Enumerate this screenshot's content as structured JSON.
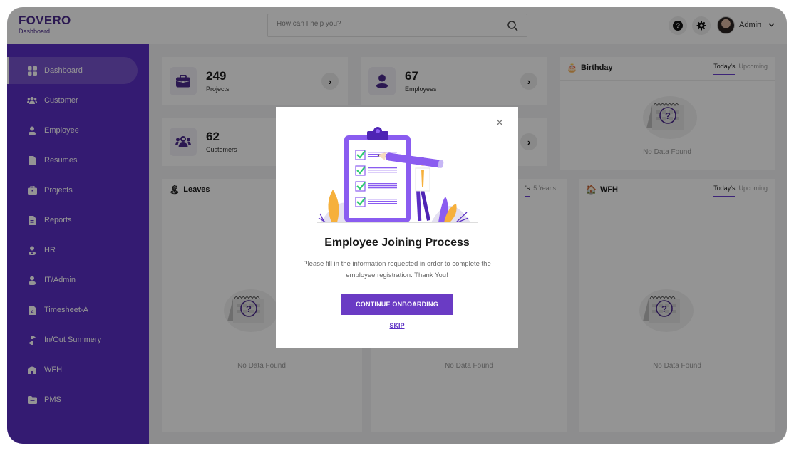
{
  "header": {
    "brand": "FOVERO",
    "subtitle": "Dashboard",
    "search_placeholder": "How can I help you?",
    "help_icon": "help-icon",
    "settings_icon": "gear-icon",
    "user_name": "Admin",
    "user_chevron": "⌄"
  },
  "sidebar": {
    "items": [
      {
        "label": "Dashboard",
        "icon": "grid-icon",
        "active": true
      },
      {
        "label": "Customer",
        "icon": "users-icon"
      },
      {
        "label": "Employee",
        "icon": "user-icon"
      },
      {
        "label": "Resumes",
        "icon": "file-icon"
      },
      {
        "label": "Projects",
        "icon": "briefcase-icon"
      },
      {
        "label": "Reports",
        "icon": "report-icon"
      },
      {
        "label": "HR",
        "icon": "hr-icon"
      },
      {
        "label": "IT/Admin",
        "icon": "admin-icon"
      },
      {
        "label": "Timesheet-A",
        "icon": "timesheet-icon"
      },
      {
        "label": "In/Out Summery",
        "icon": "swap-icon"
      },
      {
        "label": "WFH",
        "icon": "home-icon"
      },
      {
        "label": "PMS",
        "icon": "folder-icon"
      }
    ]
  },
  "stats": [
    {
      "value": "249",
      "label": "Projects",
      "icon": "briefcase-icon"
    },
    {
      "value": "67",
      "label": "Employees",
      "icon": "user-icon"
    },
    {
      "value": "62",
      "label": "Customers",
      "icon": "users-icon"
    },
    {
      "value": "",
      "label": "",
      "icon": ""
    }
  ],
  "panels": {
    "birthday": {
      "title": "Birthday",
      "icon": "🎂",
      "tabs": [
        "Today's",
        "Upcoming"
      ],
      "empty": "No Data Found"
    },
    "leaves": {
      "title": "Leaves",
      "icon": "🏝",
      "empty": "No Data Found"
    },
    "middle": {
      "tabs": [
        "'s",
        "5 Year's"
      ],
      "empty": "No Data Found"
    },
    "wfh": {
      "title": "WFH",
      "icon": "🏠",
      "tabs": [
        "Today's",
        "Upcoming"
      ],
      "empty": "No Data Found"
    }
  },
  "modal": {
    "title": "Employee Joining Process",
    "text": "Please fill in the information requested in order to complete the employee registration. Thank You!",
    "continue_label": "CONTINUE ONBOARDING",
    "skip_label": "SKIP",
    "close_glyph": "×"
  },
  "colors": {
    "brand": "#5b2fc4",
    "button": "#6a3bc4",
    "check": "#2ecc71"
  }
}
